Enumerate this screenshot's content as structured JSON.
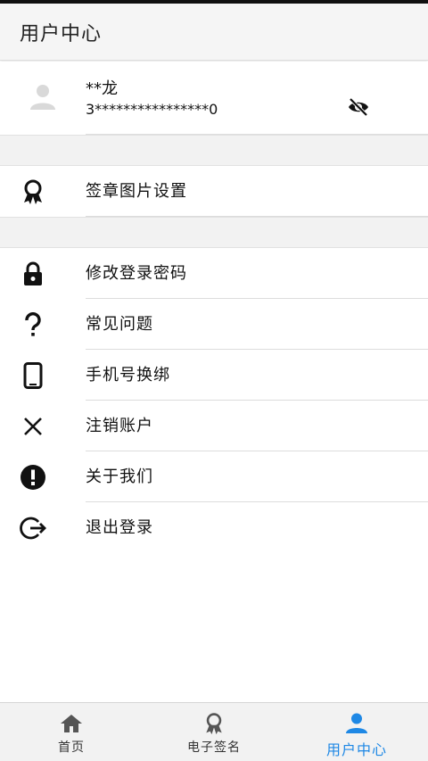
{
  "header": {
    "title": "用户中心"
  },
  "profile": {
    "name": "**龙",
    "id_masked": "3****************0"
  },
  "sections": {
    "signature": [
      {
        "label": "签章图片设置",
        "icon": "award-ribbon-icon"
      }
    ],
    "account": [
      {
        "label": "修改登录密码",
        "icon": "lock-icon"
      },
      {
        "label": "常见问题",
        "icon": "question-icon"
      },
      {
        "label": "手机号换绑",
        "icon": "phone-icon"
      },
      {
        "label": "注销账户",
        "icon": "close-icon"
      },
      {
        "label": "关于我们",
        "icon": "alert-circle-icon"
      },
      {
        "label": "退出登录",
        "icon": "logout-icon"
      }
    ]
  },
  "bottom_nav": {
    "items": [
      {
        "label": "首页",
        "icon": "home-icon"
      },
      {
        "label": "电子签名",
        "icon": "award-ribbon-icon"
      },
      {
        "label": "用户中心",
        "icon": "person-icon",
        "active": true
      }
    ]
  },
  "colors": {
    "accent": "#1e88e5",
    "nav_inactive_icon": "#555555"
  }
}
